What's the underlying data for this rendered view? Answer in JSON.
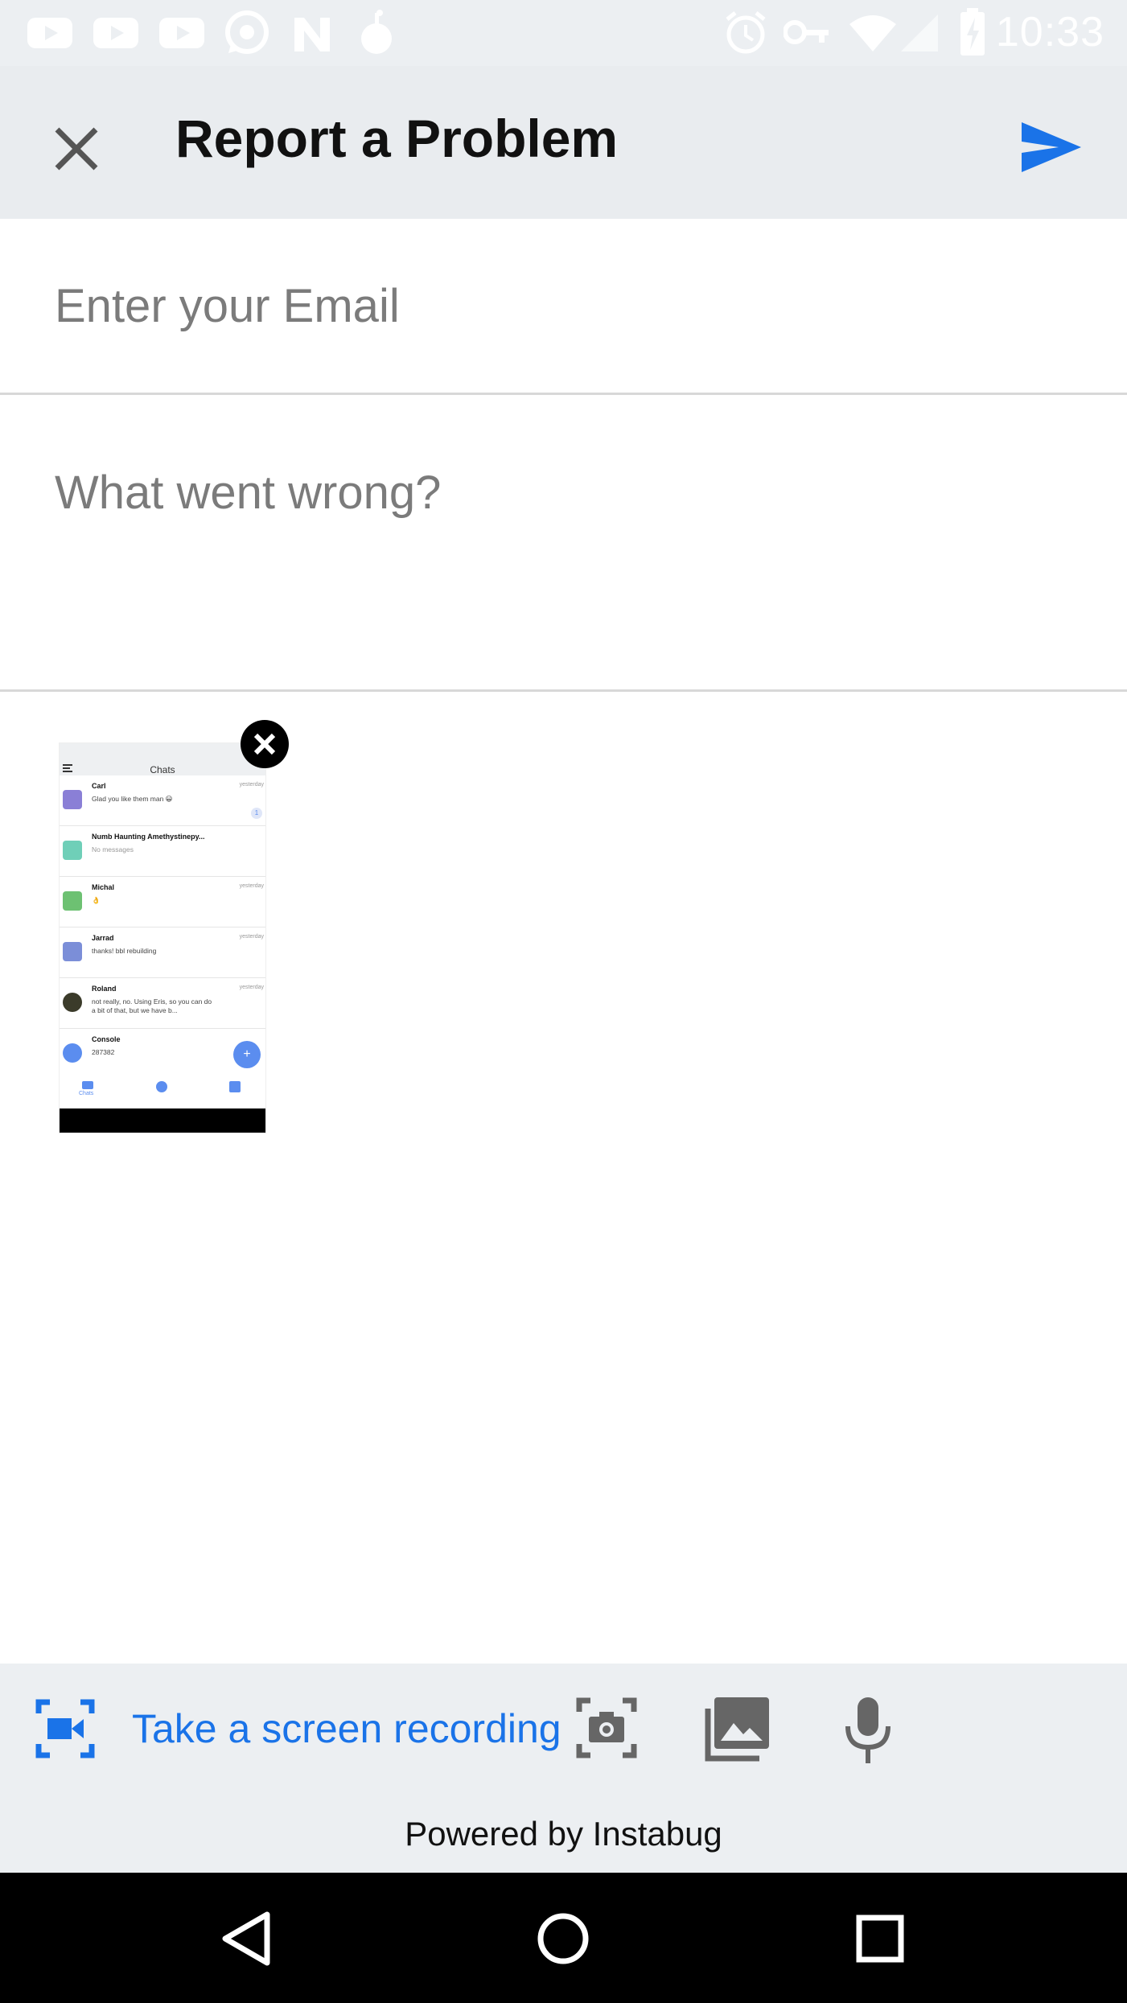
{
  "status_bar": {
    "time": "10:33",
    "icons": [
      "youtube-icon",
      "youtube-icon",
      "youtube-icon",
      "whatsapp-icon",
      "n-app-icon",
      "bomb-icon",
      "alarm-icon",
      "vpn-key-icon",
      "wifi-icon",
      "cellular-signal-icon",
      "battery-charging-icon"
    ]
  },
  "toolbar": {
    "title": "Report a Problem",
    "close_icon": "close-icon",
    "send_icon": "send-icon",
    "accent_color": "#1a73e8"
  },
  "form": {
    "email_placeholder": "Enter your Email",
    "email_value": "",
    "message_placeholder": "What went wrong?",
    "message_value": ""
  },
  "attachment": {
    "screen_title": "Chats",
    "chats": [
      {
        "name": "Carl",
        "message": "Glad you like them man 😀",
        "time": "yesterday",
        "badge": "1"
      },
      {
        "name": "Numb Haunting Amethystinepy...",
        "message": "No messages",
        "time": ""
      },
      {
        "name": "Michal",
        "message": "👌",
        "time": "yesterday"
      },
      {
        "name": "Jarrad",
        "message": "thanks! bbl rebuilding",
        "time": "yesterday"
      },
      {
        "name": "Roland",
        "message": "not really, no. Using Eris, so you can do a bit of that, but we have b...",
        "time": "yesterday"
      },
      {
        "name": "Console",
        "message": "287382",
        "time": ""
      }
    ],
    "fab_label": "+",
    "nav_label": "Chats"
  },
  "action_bar": {
    "record_label": "Take a screen recording",
    "record_icon": "screen-record-icon",
    "screenshot_icon": "screenshot-icon",
    "gallery_icon": "gallery-icon",
    "mic_icon": "microphone-icon",
    "powered_by": "Powered by Instabug"
  },
  "nav_bar": {
    "icons": [
      "back-triangle-icon",
      "home-circle-icon",
      "recents-square-icon"
    ]
  }
}
